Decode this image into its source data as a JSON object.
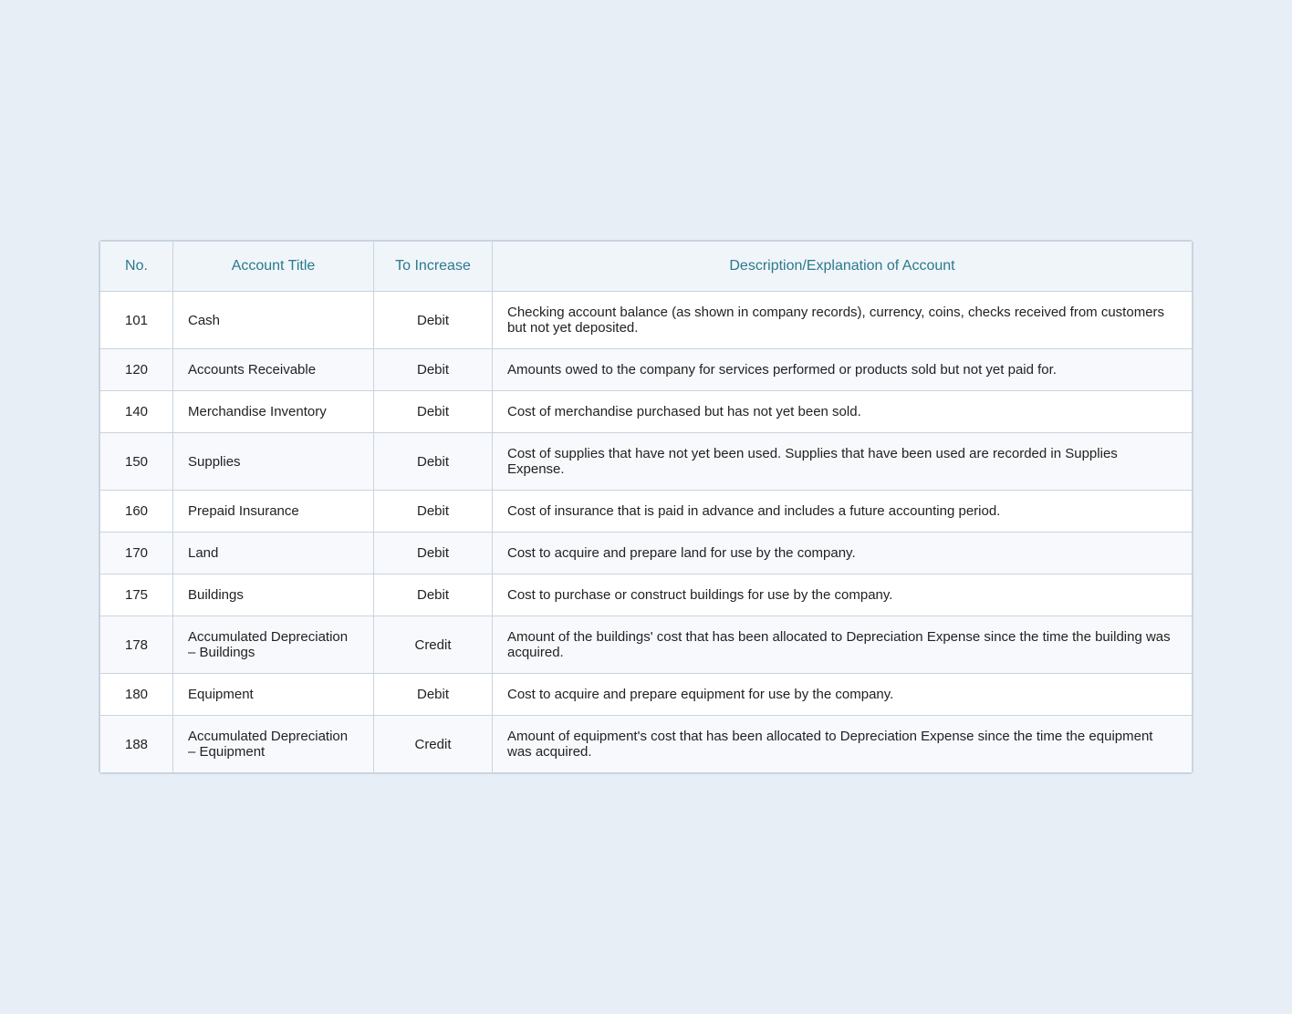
{
  "table": {
    "headers": {
      "no": "No.",
      "account_title": "Account Title",
      "to_increase": "To Increase",
      "description": "Description/Explanation of Account"
    },
    "rows": [
      {
        "no": "101",
        "account_title": "Cash",
        "to_increase": "Debit",
        "description": "Checking account balance (as shown in company records), currency, coins, checks received from customers but not yet deposited."
      },
      {
        "no": "120",
        "account_title": "Accounts Receivable",
        "to_increase": "Debit",
        "description": "Amounts owed to the company for services performed or products sold but not yet paid for."
      },
      {
        "no": "140",
        "account_title": "Merchandise Inventory",
        "to_increase": "Debit",
        "description": "Cost of merchandise purchased but has not yet been sold."
      },
      {
        "no": "150",
        "account_title": "Supplies",
        "to_increase": "Debit",
        "description": "Cost of supplies that have not yet been used. Supplies that have been used are recorded in Supplies Expense."
      },
      {
        "no": "160",
        "account_title": "Prepaid Insurance",
        "to_increase": "Debit",
        "description": "Cost of insurance that is paid in advance and includes a future accounting period."
      },
      {
        "no": "170",
        "account_title": "Land",
        "to_increase": "Debit",
        "description": "Cost to acquire and prepare land for use by the company."
      },
      {
        "no": "175",
        "account_title": "Buildings",
        "to_increase": "Debit",
        "description": "Cost to purchase or construct buildings for use by the company."
      },
      {
        "no": "178",
        "account_title": "Accumulated Depreciation – Buildings",
        "to_increase": "Credit",
        "description": "Amount of the buildings' cost that has been allocated to Depreciation Expense since the time the building was acquired."
      },
      {
        "no": "180",
        "account_title": "Equipment",
        "to_increase": "Debit",
        "description": "Cost to acquire and prepare equipment for use by the company."
      },
      {
        "no": "188",
        "account_title": "Accumulated Depreciation – Equipment",
        "to_increase": "Credit",
        "description": "Amount of equipment's cost that has been allocated to Depreciation Expense since the time the equipment was acquired."
      }
    ]
  }
}
